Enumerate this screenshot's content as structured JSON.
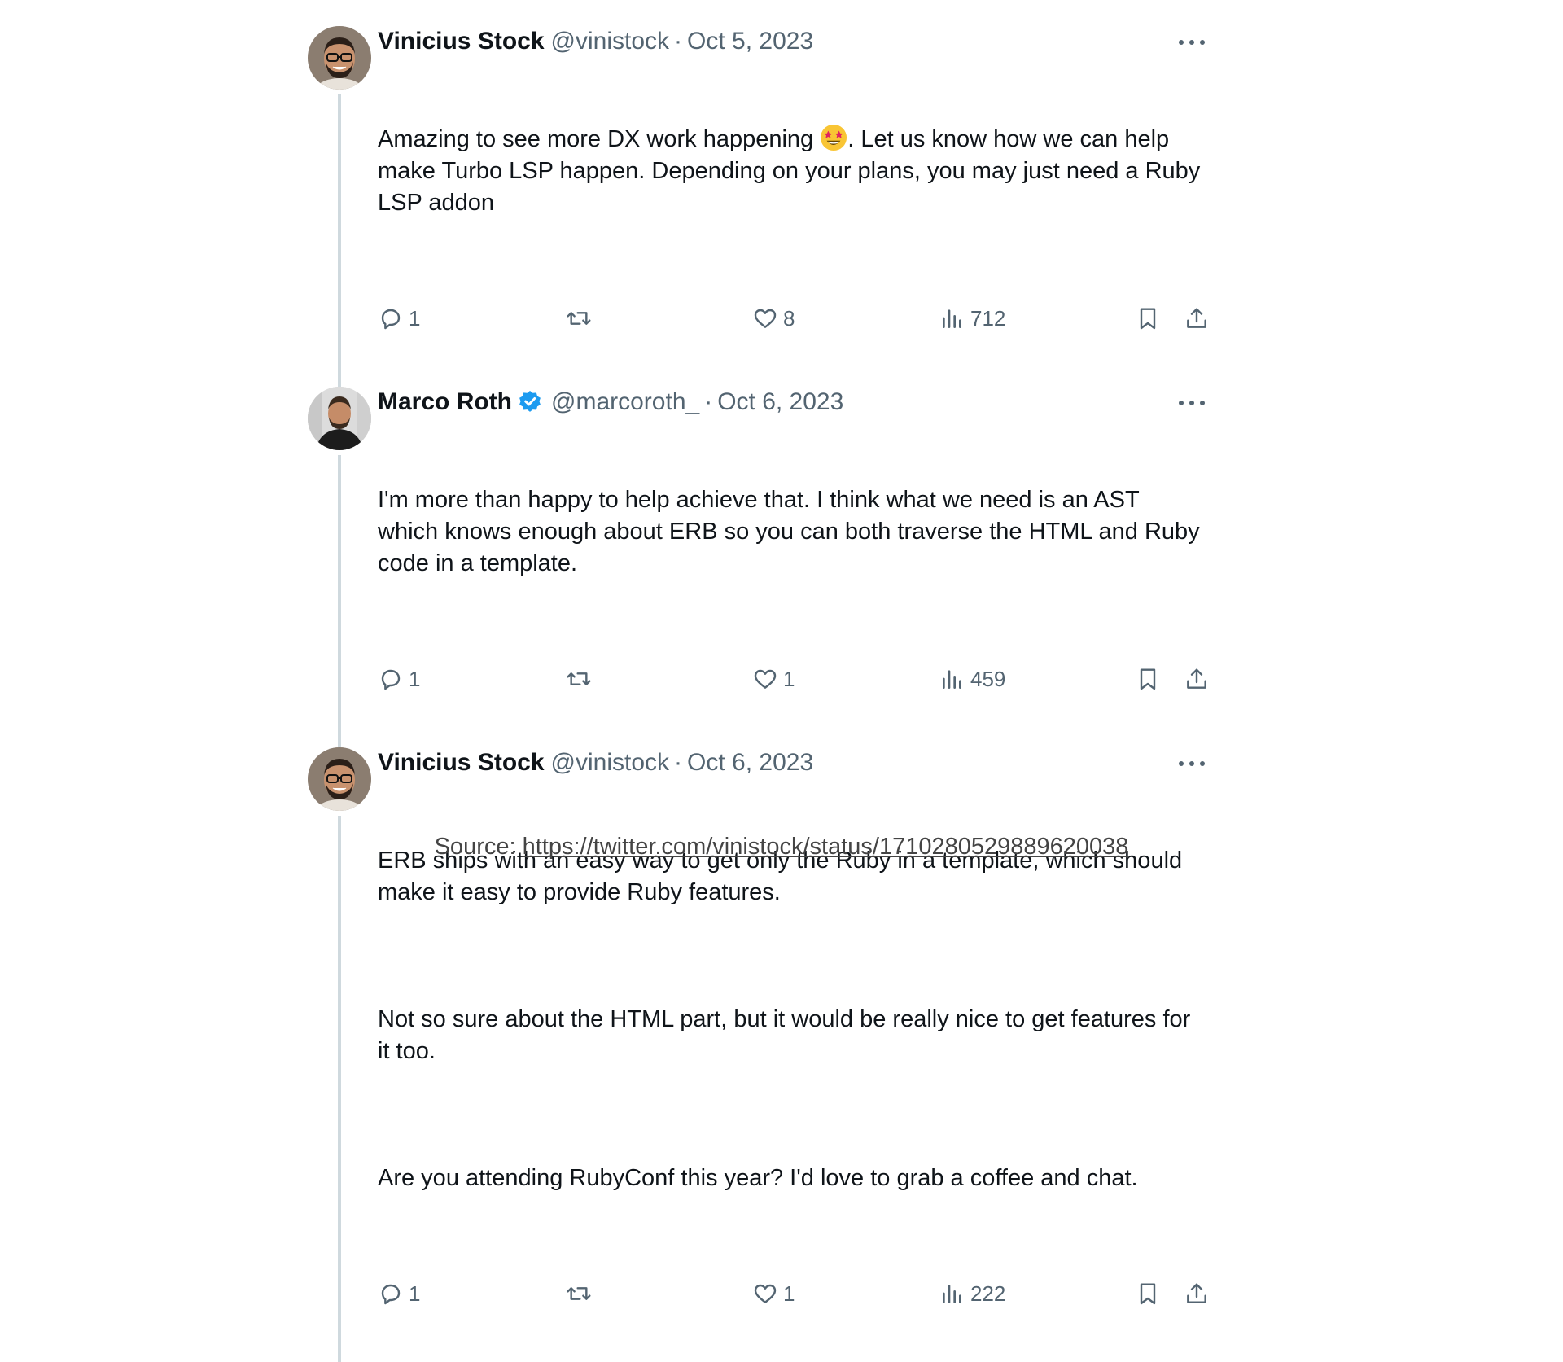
{
  "tweets": [
    {
      "author": "Vinicius Stock",
      "handle": "@vinistock",
      "separator": "·",
      "date": "Oct 5, 2023",
      "verified": false,
      "avatar": "vinicius-avatar",
      "paragraphs": [
        {
          "before": "Amazing to see more DX work happening ",
          "emoji": "star-struck-emoji",
          "after": ". Let us know how we can help make Turbo LSP happen. Depending on your plans, you may just need a Ruby LSP addon"
        }
      ],
      "replies": "1",
      "likes": "8",
      "views": "712"
    },
    {
      "author": "Marco Roth",
      "handle": "@marcoroth_",
      "separator": "·",
      "date": "Oct 6, 2023",
      "verified": true,
      "avatar": "marco-avatar",
      "paragraphs": [
        {
          "before": "I'm more than happy to help achieve that. I think what we need is an AST which knows enough about ERB so you can both traverse the HTML and Ruby code in a template.",
          "emoji": null,
          "after": ""
        }
      ],
      "replies": "1",
      "likes": "1",
      "views": "459"
    },
    {
      "author": "Vinicius Stock",
      "handle": "@vinistock",
      "separator": "·",
      "date": "Oct 6, 2023",
      "verified": false,
      "avatar": "vinicius-avatar",
      "paragraphs": [
        {
          "before": "ERB ships with an easy way to get only the Ruby in a template, which should make it easy to provide Ruby features.",
          "emoji": null,
          "after": ""
        },
        {
          "before": "Not so sure about the HTML part, but it would be really nice to get features for it too.",
          "emoji": null,
          "after": ""
        },
        {
          "before": "Are you attending RubyConf this year? I'd love to grab a coffee and chat.",
          "emoji": null,
          "after": ""
        }
      ],
      "replies": "1",
      "likes": "1",
      "views": "222"
    }
  ],
  "source": {
    "label": "Source: ",
    "url": "https://twitter.com/vinistock/status/1710280529889620038"
  },
  "colors": {
    "text": "#0f1419",
    "muted": "#536471",
    "thread_line": "#cfd9de",
    "verified": "#1d9bf0"
  }
}
